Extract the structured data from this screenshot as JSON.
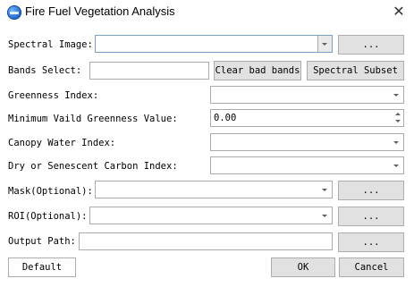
{
  "window": {
    "title": "Fire Fuel Vegetation Analysis",
    "icon": "app-globe-icon",
    "close_glyph": "✕"
  },
  "form": {
    "spectral_image": {
      "label": "Spectral Image:",
      "value": "",
      "browse_label": "..."
    },
    "bands_select": {
      "label": "Bands Select:",
      "value": "",
      "clear_label": "Clear bad bands",
      "subset_label": "Spectral Subset"
    },
    "greenness_index": {
      "label": "Greenness Index:",
      "value": ""
    },
    "min_greenness": {
      "label": "Minimum Vaild Greenness Value:",
      "value": "0.00"
    },
    "canopy_water_index": {
      "label": "Canopy Water Index:",
      "value": ""
    },
    "dry_carbon_index": {
      "label": "Dry or Senescent Carbon Index:",
      "value": ""
    },
    "mask": {
      "label": "Mask(Optional):",
      "value": "",
      "browse_label": "..."
    },
    "roi": {
      "label": "ROI(Optional):",
      "value": "",
      "browse_label": "..."
    },
    "output_path": {
      "label": "Output Path:",
      "value": "",
      "browse_label": "..."
    }
  },
  "footer": {
    "default_label": "Default",
    "ok_label": "OK",
    "cancel_label": "Cancel"
  }
}
